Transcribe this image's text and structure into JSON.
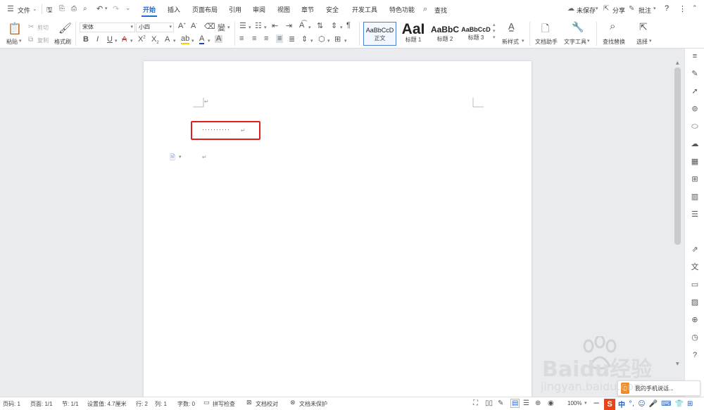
{
  "menubar": {
    "file_label": "文件",
    "tabs": [
      {
        "label": "开始",
        "active": true
      },
      {
        "label": "插入",
        "active": false
      },
      {
        "label": "页面布局",
        "active": false
      },
      {
        "label": "引用",
        "active": false
      },
      {
        "label": "审阅",
        "active": false
      },
      {
        "label": "视图",
        "active": false
      },
      {
        "label": "章节",
        "active": false
      },
      {
        "label": "安全",
        "active": false
      },
      {
        "label": "开发工具",
        "active": false
      },
      {
        "label": "特色功能",
        "active": false
      }
    ],
    "search_label": "查找",
    "unsaved_label": "未保存",
    "share_label": "分享",
    "comment_label": "批注",
    "help_label": "?",
    "more_label": "⋮",
    "accent": "#1f6ad6"
  },
  "ribbon": {
    "paste_label": "粘贴",
    "cut_label": "剪切",
    "copy_label": "复制",
    "format_painter_label": "格式刷",
    "font_name": "宋体",
    "font_size": "小四",
    "styles": [
      {
        "sample": "AaBbCcD",
        "label": "正文",
        "selected": true
      },
      {
        "sample": "AaI",
        "label": "标题 1",
        "selected": false
      },
      {
        "sample": "AaBbC",
        "label": "标题 2",
        "selected": false
      },
      {
        "sample": "AaBbCcD",
        "label": "标题 3",
        "selected": false
      }
    ],
    "new_style_label": "新样式",
    "doc_assistant_label": "文档助手",
    "text_tools_label": "文字工具",
    "find_replace_label": "查找替换",
    "select_label": "选择"
  },
  "document": {
    "dotted_text": "··········",
    "paragraph_mark": "↵"
  },
  "statusbar": {
    "page_no": "页码: 1",
    "pages": "页面: 1/1",
    "section": "节: 1/1",
    "setting": "设置值: 4.7厘米",
    "row": "行: 2",
    "col": "列: 1",
    "word_count": "字数: 0",
    "spell_check": "拼写检查",
    "doc_proof": "文档校对",
    "doc_unprotected": "文档未保护",
    "zoom": "100%"
  },
  "ime": {
    "mode": "中"
  },
  "toast": {
    "text": "我的手机说话..."
  },
  "watermark": {
    "text": "Baidu经验",
    "url_text": "jingyan.baidu.com"
  }
}
